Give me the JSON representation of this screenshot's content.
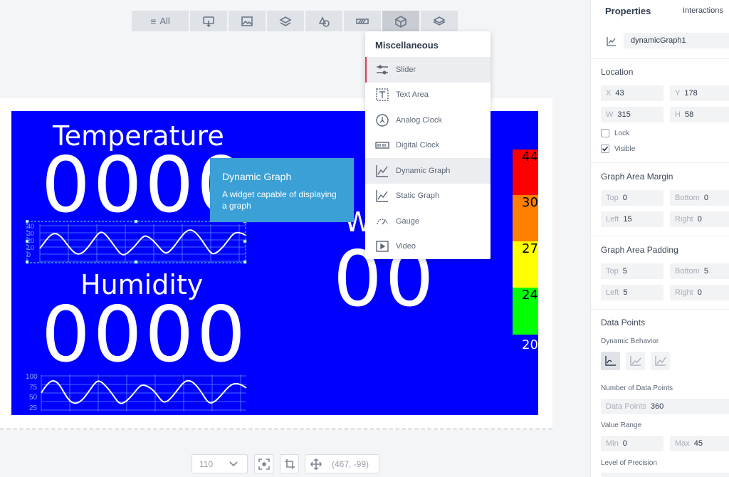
{
  "toolbar": {
    "all_label": "All",
    "icons": [
      "touch-icon",
      "image-icon",
      "layers-icon",
      "shapes-icon",
      "progress-icon",
      "cube-icon",
      "stack-icon"
    ]
  },
  "canvas": {
    "temperature_label": "Temperature",
    "temperature_value": "0000",
    "humidity_label": "Humidity",
    "humidity_value": "0000",
    "partial_label": "W",
    "partial_value": "00",
    "graph1_ticks": [
      "40",
      "30",
      "20",
      "10",
      "0"
    ],
    "graph2_ticks": [
      "100",
      "75",
      "50",
      "25"
    ],
    "colorbar": {
      "values": [
        "44",
        "30",
        "27",
        "24"
      ],
      "colors": [
        "#ff0000",
        "#ff7f00",
        "#ffff00",
        "#00ff00"
      ],
      "bottom_label": "20"
    }
  },
  "tooltip": {
    "title": "Dynamic Graph",
    "description": "A widget capable of displaying a graph"
  },
  "dropdown": {
    "header": "Miscellaneous",
    "items": [
      {
        "label": "Slider",
        "icon": "slider-icon"
      },
      {
        "label": "Text Area",
        "icon": "text-area-icon"
      },
      {
        "label": "Analog Clock",
        "icon": "analog-clock-icon"
      },
      {
        "label": "Digital Clock",
        "icon": "digital-clock-icon"
      },
      {
        "label": "Dynamic Graph",
        "icon": "dynamic-graph-icon"
      },
      {
        "label": "Static Graph",
        "icon": "static-graph-icon"
      },
      {
        "label": "Gauge",
        "icon": "gauge-icon"
      },
      {
        "label": "Video",
        "icon": "video-icon"
      }
    ]
  },
  "bottombar": {
    "zoom": "110",
    "coords": "(467, -99)"
  },
  "properties": {
    "tab_properties": "Properties",
    "tab_interactions": "Interactions",
    "name": "dynamicGraph1",
    "location_title": "Location",
    "x_label": "X",
    "x": "43",
    "y_label": "Y",
    "y": "178",
    "w_label": "W",
    "w": "315",
    "h_label": "H",
    "h": "58",
    "lock_label": "Lock",
    "visible_label": "Visible",
    "margin_title": "Graph Area Margin",
    "padding_title": "Graph Area Padding",
    "top_label": "Top",
    "bottom_label": "Bottom",
    "left_label": "Left",
    "right_label": "Right",
    "margin": {
      "top": "0",
      "bottom": "0",
      "left": "15",
      "right": "0"
    },
    "padding": {
      "top": "5",
      "bottom": "5",
      "left": "5",
      "right": "0"
    },
    "data_points_title": "Data Points",
    "dynamic_behavior_label": "Dynamic Behavior",
    "num_points_label": "Number of Data Points",
    "data_points_field_label": "Data Points",
    "data_points_value": "360",
    "value_range_label": "Value Range",
    "min_label": "Min",
    "min": "0",
    "max_label": "Max",
    "max": "45",
    "precision_label": "Level of Precision"
  }
}
